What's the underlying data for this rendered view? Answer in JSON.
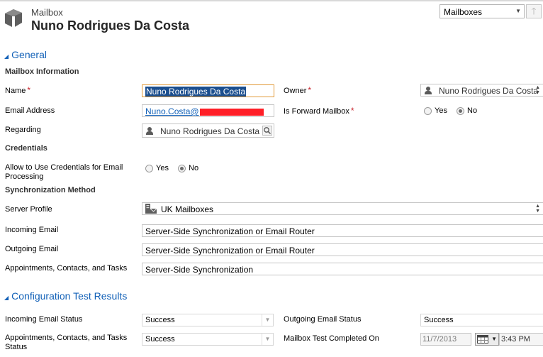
{
  "header": {
    "entity_label": "Mailbox",
    "record_title": "Nuno Rodrigues Da Costa",
    "form_selector": "Mailboxes",
    "up_arrow": "🡑"
  },
  "general": {
    "section_title": "General",
    "mailbox_info_heading": "Mailbox Information",
    "name_label": "Name",
    "name_value": "Nuno Rodrigues Da Costa",
    "owner_label": "Owner",
    "owner_value": "Nuno Rodrigues Da Costa",
    "email_label": "Email Address",
    "email_value": "Nuno.Costa@",
    "forward_label": "Is Forward Mailbox",
    "forward_yes": "Yes",
    "forward_no": "No",
    "regarding_label": "Regarding",
    "regarding_value": "Nuno Rodrigues Da Costa",
    "credentials_heading": "Credentials",
    "allow_creds_label": "Allow to Use Credentials for Email Processing",
    "creds_yes": "Yes",
    "creds_no": "No",
    "sync_heading": "Synchronization Method",
    "server_profile_label": "Server Profile",
    "server_profile_value": "UK Mailboxes",
    "incoming_label": "Incoming Email",
    "incoming_value": "Server-Side Synchronization or Email Router",
    "outgoing_label": "Outgoing Email",
    "outgoing_value": "Server-Side Synchronization or Email Router",
    "act_label": "Appointments, Contacts, and Tasks",
    "act_value": "Server-Side Synchronization",
    "required_mark": "*"
  },
  "config": {
    "section_title": "Configuration Test Results",
    "incoming_status_label": "Incoming Email Status",
    "incoming_status_value": "Success",
    "outgoing_status_label": "Outgoing Email Status",
    "outgoing_status_value": "Success",
    "act_status_label": "Appointments, Contacts, and Tasks Status",
    "act_status_value": "Success",
    "test_completed_label": "Mailbox Test Completed On",
    "test_date": "11/7/2013",
    "test_time": "3:43 PM"
  },
  "colors": {
    "section_blue": "#1160b7",
    "required_red": "#c8232c",
    "redaction": "#ff1f27",
    "focus_border": "#e29a38"
  },
  "icons": [
    "mailbox-entity-icon",
    "person-icon",
    "lookup-icon",
    "server-profile-icon",
    "calendar-icon",
    "chevron-down-icon",
    "arrow-up-icon"
  ]
}
